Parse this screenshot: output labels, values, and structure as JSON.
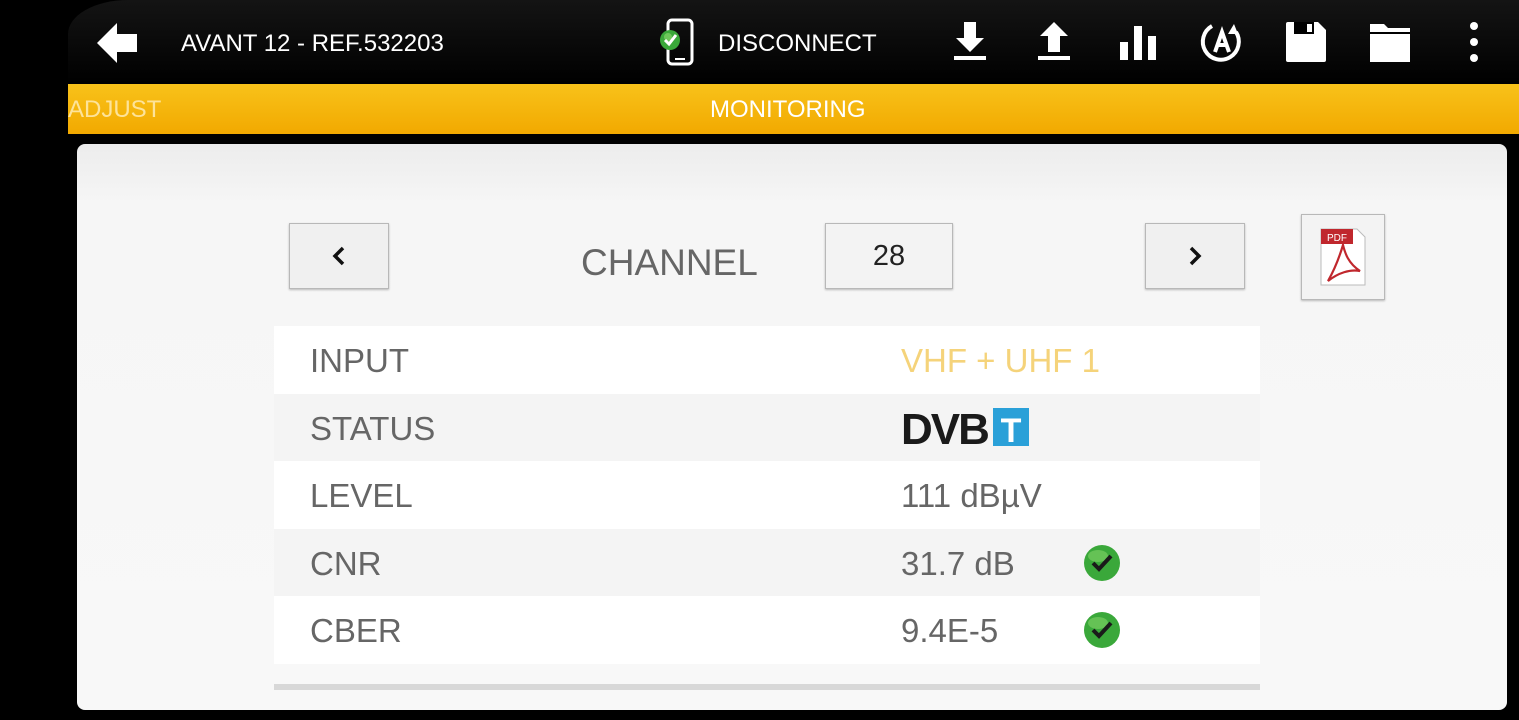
{
  "app_bar": {
    "device_title": "AVANT 12 - REF.532203",
    "connection_label": "DISCONNECT",
    "icons": [
      "back-arrow-icon",
      "connected-device-icon",
      "download-icon",
      "upload-icon",
      "bar-chart-icon",
      "auto-program-icon",
      "save-icon",
      "folder-icon",
      "more-vert-icon"
    ]
  },
  "tabs": [
    {
      "label": "ADJUST",
      "active": false
    },
    {
      "label": "MONITORING",
      "active": true
    }
  ],
  "channel": {
    "label": "CHANNEL",
    "value": "28"
  },
  "measurements": [
    {
      "label": "INPUT",
      "value": "VHF + UHF 1"
    },
    {
      "label": "STATUS",
      "value_logo": "DVB-T",
      "logo_text_main": "DVB",
      "logo_text_badge": "T"
    },
    {
      "label": "LEVEL",
      "value": "111 dBµV"
    },
    {
      "label": "CNR",
      "value": "31.7 dB",
      "ok": true
    },
    {
      "label": "CBER",
      "value": "9.4E-5",
      "ok": true
    }
  ],
  "pdf_icon_text": "PDF",
  "colors": {
    "accent_tab": "#f2a900",
    "input_value": "#f5d37a",
    "check_green": "#3aa83a",
    "dvb_blue": "#2aa0d8"
  }
}
